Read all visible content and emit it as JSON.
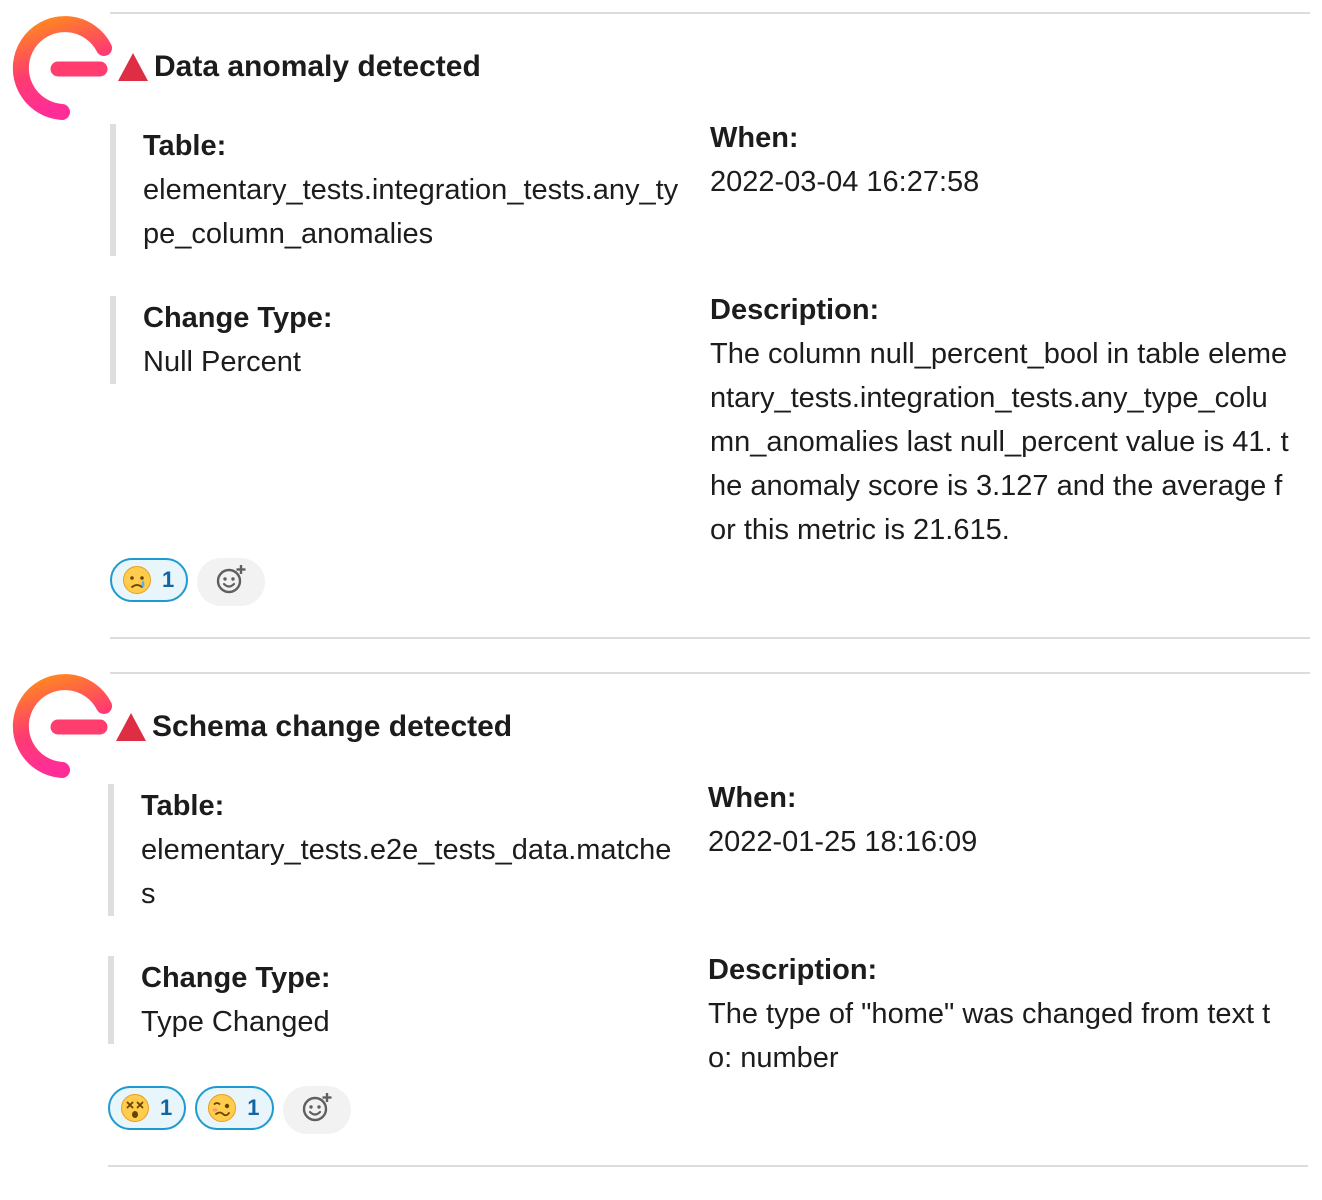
{
  "messages": [
    {
      "title": "Data anomaly detected",
      "table_label": "Table:",
      "table_value": "elementary_tests.integration_tests.any_type_column_anomalies",
      "when_label": "When:",
      "when_value": "2022-03-04 16:27:58",
      "change_label": "Change Type:",
      "change_value": "Null Percent",
      "desc_label": "Description:",
      "desc_value": "The column null_percent_bool in table elementary_tests.integration_tests.any_type_column_anomalies last null_percent value is 41. the anomaly score is 3.127 and the average for this metric is 21.615.",
      "reactions": [
        {
          "emoji": "crying-face-icon",
          "count": "1"
        }
      ]
    },
    {
      "title": "Schema change detected",
      "table_label": "Table:",
      "table_value": "elementary_tests.e2e_tests_data.matches",
      "when_label": "When:",
      "when_value": "2022-01-25 18:16:09",
      "change_label": "Change Type:",
      "change_value": "Type Changed",
      "desc_label": "Description:",
      "desc_value": "The type of \"home\" was changed from text to: number",
      "reactions": [
        {
          "emoji": "dizzy-face-icon",
          "count": "1"
        },
        {
          "emoji": "woozy-face-icon",
          "count": "1"
        }
      ]
    }
  ],
  "colors": {
    "accent": "#1d9bd1",
    "count_text": "#1264a3",
    "bar": "#dedede",
    "logo_orange": "#ff8a1d",
    "logo_pink": "#ff2e97",
    "warning_red": "#dd2e44"
  }
}
